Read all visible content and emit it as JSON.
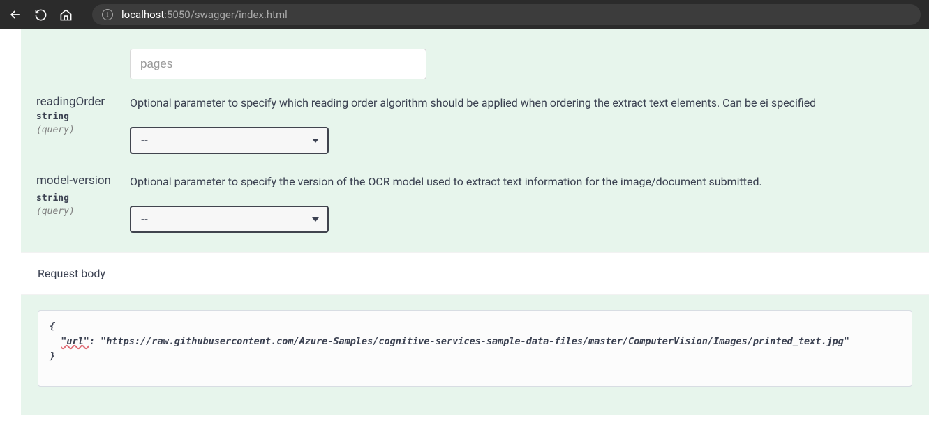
{
  "browser": {
    "url_host": "localhost",
    "url_port": ":5050",
    "url_path": "/swagger/index.html"
  },
  "params": {
    "pages": {
      "placeholder": "pages"
    },
    "readingOrder": {
      "name": "readingOrder",
      "type": "string",
      "in": "(query)",
      "description": "Optional parameter to specify which reading order algorithm should be applied when ordering the extract text elements. Can be ei specified",
      "selected": "--"
    },
    "modelVersion": {
      "name": "model-version",
      "type": "string",
      "in": "(query)",
      "description": "Optional parameter to specify the version of the OCR model used to extract text information for the image/document submitted.",
      "selected": "--"
    }
  },
  "requestBody": {
    "label": "Request body",
    "code_open": "{",
    "code_key": "\"url\"",
    "code_rest": ": \"https://raw.githubusercontent.com/Azure-Samples/cognitive-services-sample-data-files/master/ComputerVision/Images/printed_text.jpg\"",
    "code_close": "}"
  }
}
